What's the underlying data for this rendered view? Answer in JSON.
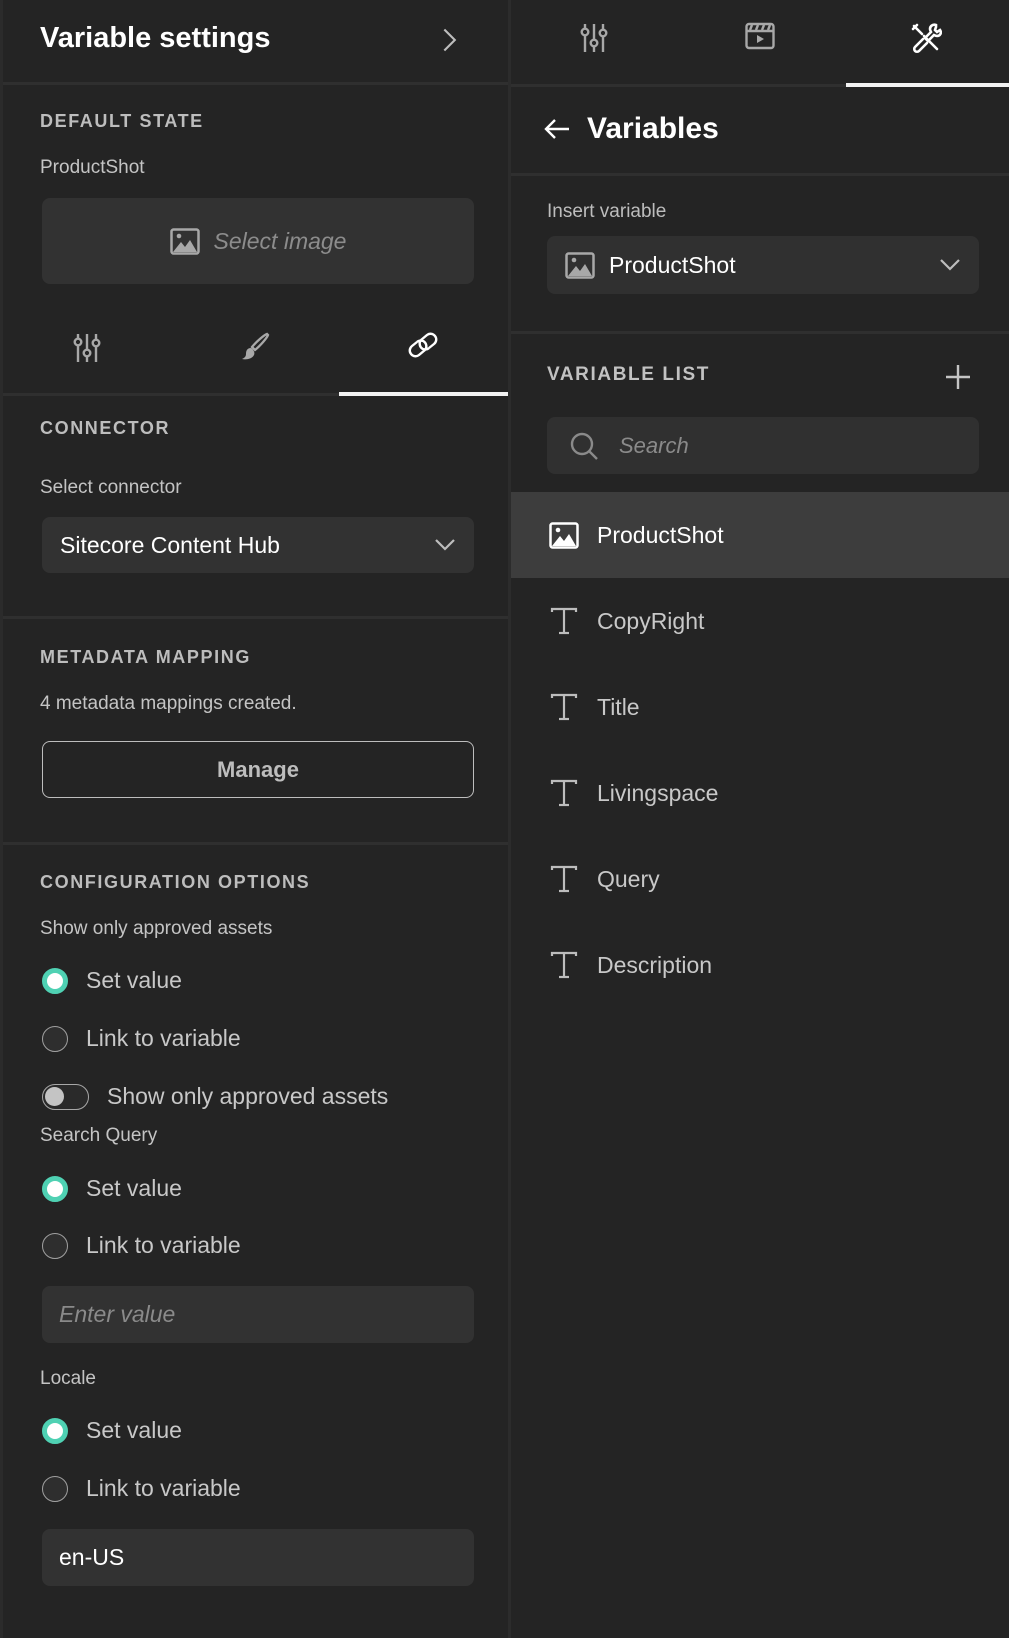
{
  "left_panel": {
    "title": "Variable settings",
    "default_state": {
      "heading": "DEFAULT STATE",
      "variable_name": "ProductShot",
      "select_image_label": "Select image"
    },
    "tabs": [
      {
        "icon": "sliders-icon",
        "active": false
      },
      {
        "icon": "brush-icon",
        "active": false
      },
      {
        "icon": "link-icon",
        "active": true
      }
    ],
    "connector": {
      "heading": "CONNECTOR",
      "label": "Select connector",
      "value": "Sitecore Content Hub"
    },
    "metadata_mapping": {
      "heading": "METADATA MAPPING",
      "summary": "4 metadata mappings created.",
      "manage_label": "Manage"
    },
    "configuration": {
      "heading": "CONFIGURATION OPTIONS",
      "approved_assets": {
        "label": "Show only approved assets",
        "options": [
          "Set value",
          "Link to variable"
        ],
        "selected": 0,
        "toggle_label": "Show only approved assets",
        "toggle_on": false
      },
      "search_query": {
        "label": "Search Query",
        "options": [
          "Set value",
          "Link to variable"
        ],
        "selected": 0,
        "placeholder": "Enter value",
        "value": ""
      },
      "locale": {
        "label": "Locale",
        "options": [
          "Set value",
          "Link to variable"
        ],
        "selected": 0,
        "value": "en-US"
      }
    }
  },
  "right_panel": {
    "tabs": [
      {
        "icon": "sliders-icon",
        "active": false
      },
      {
        "icon": "clapperboard-icon",
        "active": false
      },
      {
        "icon": "tools-icon",
        "active": true
      }
    ],
    "header": {
      "title": "Variables"
    },
    "insert_variable": {
      "label": "Insert variable",
      "value": "ProductShot"
    },
    "variable_list": {
      "heading": "VARIABLE LIST",
      "search_placeholder": "Search",
      "items": [
        {
          "name": "ProductShot",
          "type": "image",
          "selected": true
        },
        {
          "name": "CopyRight",
          "type": "text",
          "selected": false
        },
        {
          "name": "Title",
          "type": "text",
          "selected": false
        },
        {
          "name": "Livingspace",
          "type": "text",
          "selected": false
        },
        {
          "name": "Query",
          "type": "text",
          "selected": false
        },
        {
          "name": "Description",
          "type": "text",
          "selected": false
        }
      ]
    }
  },
  "colors": {
    "background": "#242424",
    "field": "#323232",
    "selected_row": "#3d3d3d",
    "accent_radio": "#4fd1b3",
    "text_primary": "#ffffff",
    "text_secondary": "#c4c4c4"
  }
}
